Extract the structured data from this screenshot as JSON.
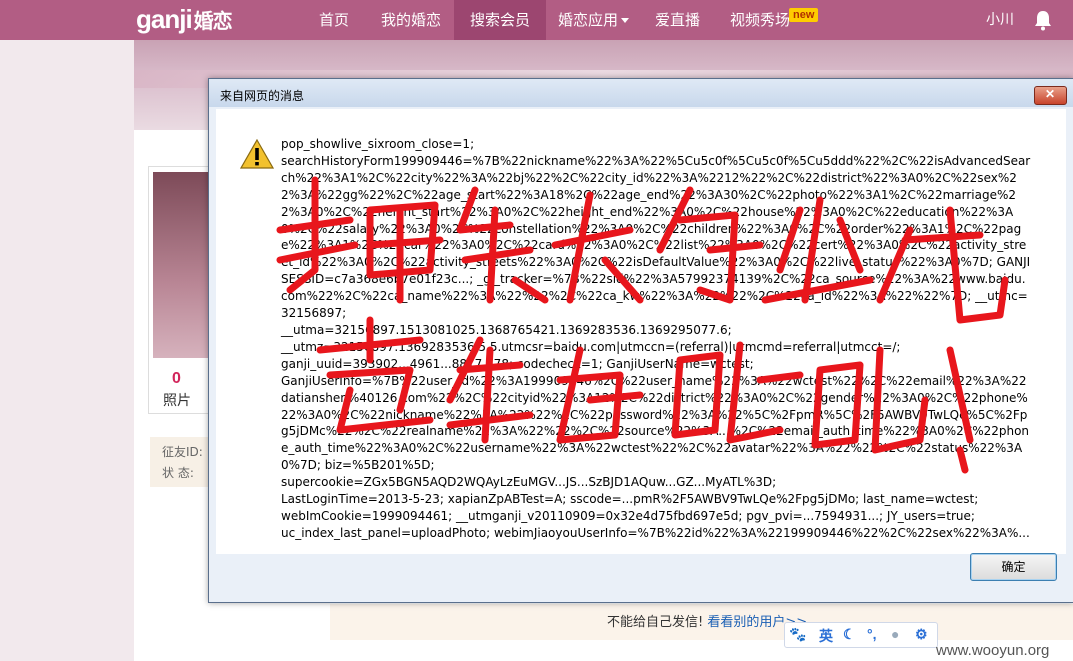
{
  "nav": {
    "logo": "ganji",
    "logo_sub": "婚恋",
    "items": [
      {
        "label": "首页"
      },
      {
        "label": "我的婚恋"
      },
      {
        "label": "搜索会员"
      },
      {
        "label": "婚恋应用"
      },
      {
        "label": "爱直播"
      },
      {
        "label": "视频秀场"
      }
    ],
    "new_badge": "new",
    "user_name": "小川"
  },
  "profile": {
    "photo_count": "0",
    "photo_label": "照片",
    "info_rows": [
      "征友ID:",
      "状  态:"
    ]
  },
  "bottom": {
    "message": "不能给自己发信! ",
    "link": "看看别的用户>>"
  },
  "ime": {
    "lang": "英"
  },
  "watermark": "www.wooyun.org",
  "dialog": {
    "title": "来自网页的消息",
    "message": "pop_showlive_sixroom_close=1;\nsearchHistoryForm199909446=%7B%22nickname%22%3A%22%5Cu5c0f%5Cu5c0f%5Cu5ddd%22%2C%22isAdvancedSearch%22%3A1%2C%22city%22%3A%22bj%22%2C%22city_id%22%3A%2212%22%2C%22district%22%3A0%2C%22sex%22%3A%22gg%22%2C%22age_start%22%3A18%2C%22age_end%22%3A30%2C%22photo%22%3A1%2C%22marriage%22%3A0%2C%22height_start%22%3A0%2C%22height_end%22%3A0%2C%22house%22%3A0%2C%22education%22%3A0%2C%22salary%22%3A0%2C%22constellation%22%3A0%2C%22children%22%3A0%2C%22order%22%3A1%2C%22page%22%3A1%2C%22car%22%3A0%2C%22card%22%3A0%2C%22list%22%3A0%2C%22cert%22%3A0%2C%22activity_street_id%22%3A0%2C%22activity_streets%22%3A0%2C%22isDefaultValue%22%3A0%2C%22live_status%22%3A0%7D; GANJISESSID=c7a368e6b7e01f23c...; _gl_tracker=%7B%22sid%22%3A57992374139%2C%22ca_source%22%3A%22www.baidu.com%22%2C%22ca_name%22%3A%22%22%2C%22ca_kw%22%3A%22%22%2C%22ca_id%22%3A%22%22%7D; __utmc=32156897;\n__utma=32156897.1513081025.1368765421.1369283536.1369295077.6;\n__utmz=32156897.1369283536.5.5.utmcsr=baidu.com|utmccn=(referral)|utmcmd=referral|utmcct=/;\nganji_uuid=393902...4961...8817...78; codecheck=1; GanjiUserName=wctest;\nGanjiUserInfo=%7B%22user_id%22%3A199909446%2C%22user_name%22%3A%22wctest%22%2C%22email%22%3A%22datianshen%40126.com%22%2C%22cityid%22%3A12%2C%22district%22%3A0%2C%22gender%22%3A0%2C%22phone%22%3A0%2C%22nickname%22%3A%22%22%2C%22password%22%3A%22%5C%2FpmR%5C%2F5AWBV9TwLQe%5C%2Fpg5jDMc%22%2C%22realname%22%3A%22%22%2C%22source%22%3A...%2C%22email_auth_time%22%3A0%2C%22phone_auth_time%22%3A0%2C%22username%22%3A%22wctest%22%2C%22avatar%22%3A%22%22%2C%22status%22%3A0%7D; biz=%5B201%5D;\nsupercookie=ZGx5BGN5AQD2WQAyLzEuMGV...JS...SzBJD1AQuw...GZ...MyATL%3D;\nLastLoginTime=2013-5-23; xapianZpABTest=A; sscode=...pmR%2F5AWBV9TwLQe%2Fpg5jDMo; last_name=wctest;\nwebImCookie=1999094461; __utmganji_v20110909=0x32e4d75fbd697e5d; pgv_pvi=...7594931...; JY_users=true;\nuc_index_last_panel=uploadPhoto; webimJiaoyouUserInfo=%7B%22id%22%3A%22199909446%22%2C%22sex%22%3A%...",
    "ok_label": "确定"
  },
  "colors": {
    "nav_bg": "#b25d84",
    "annotation": "#e8161c"
  }
}
